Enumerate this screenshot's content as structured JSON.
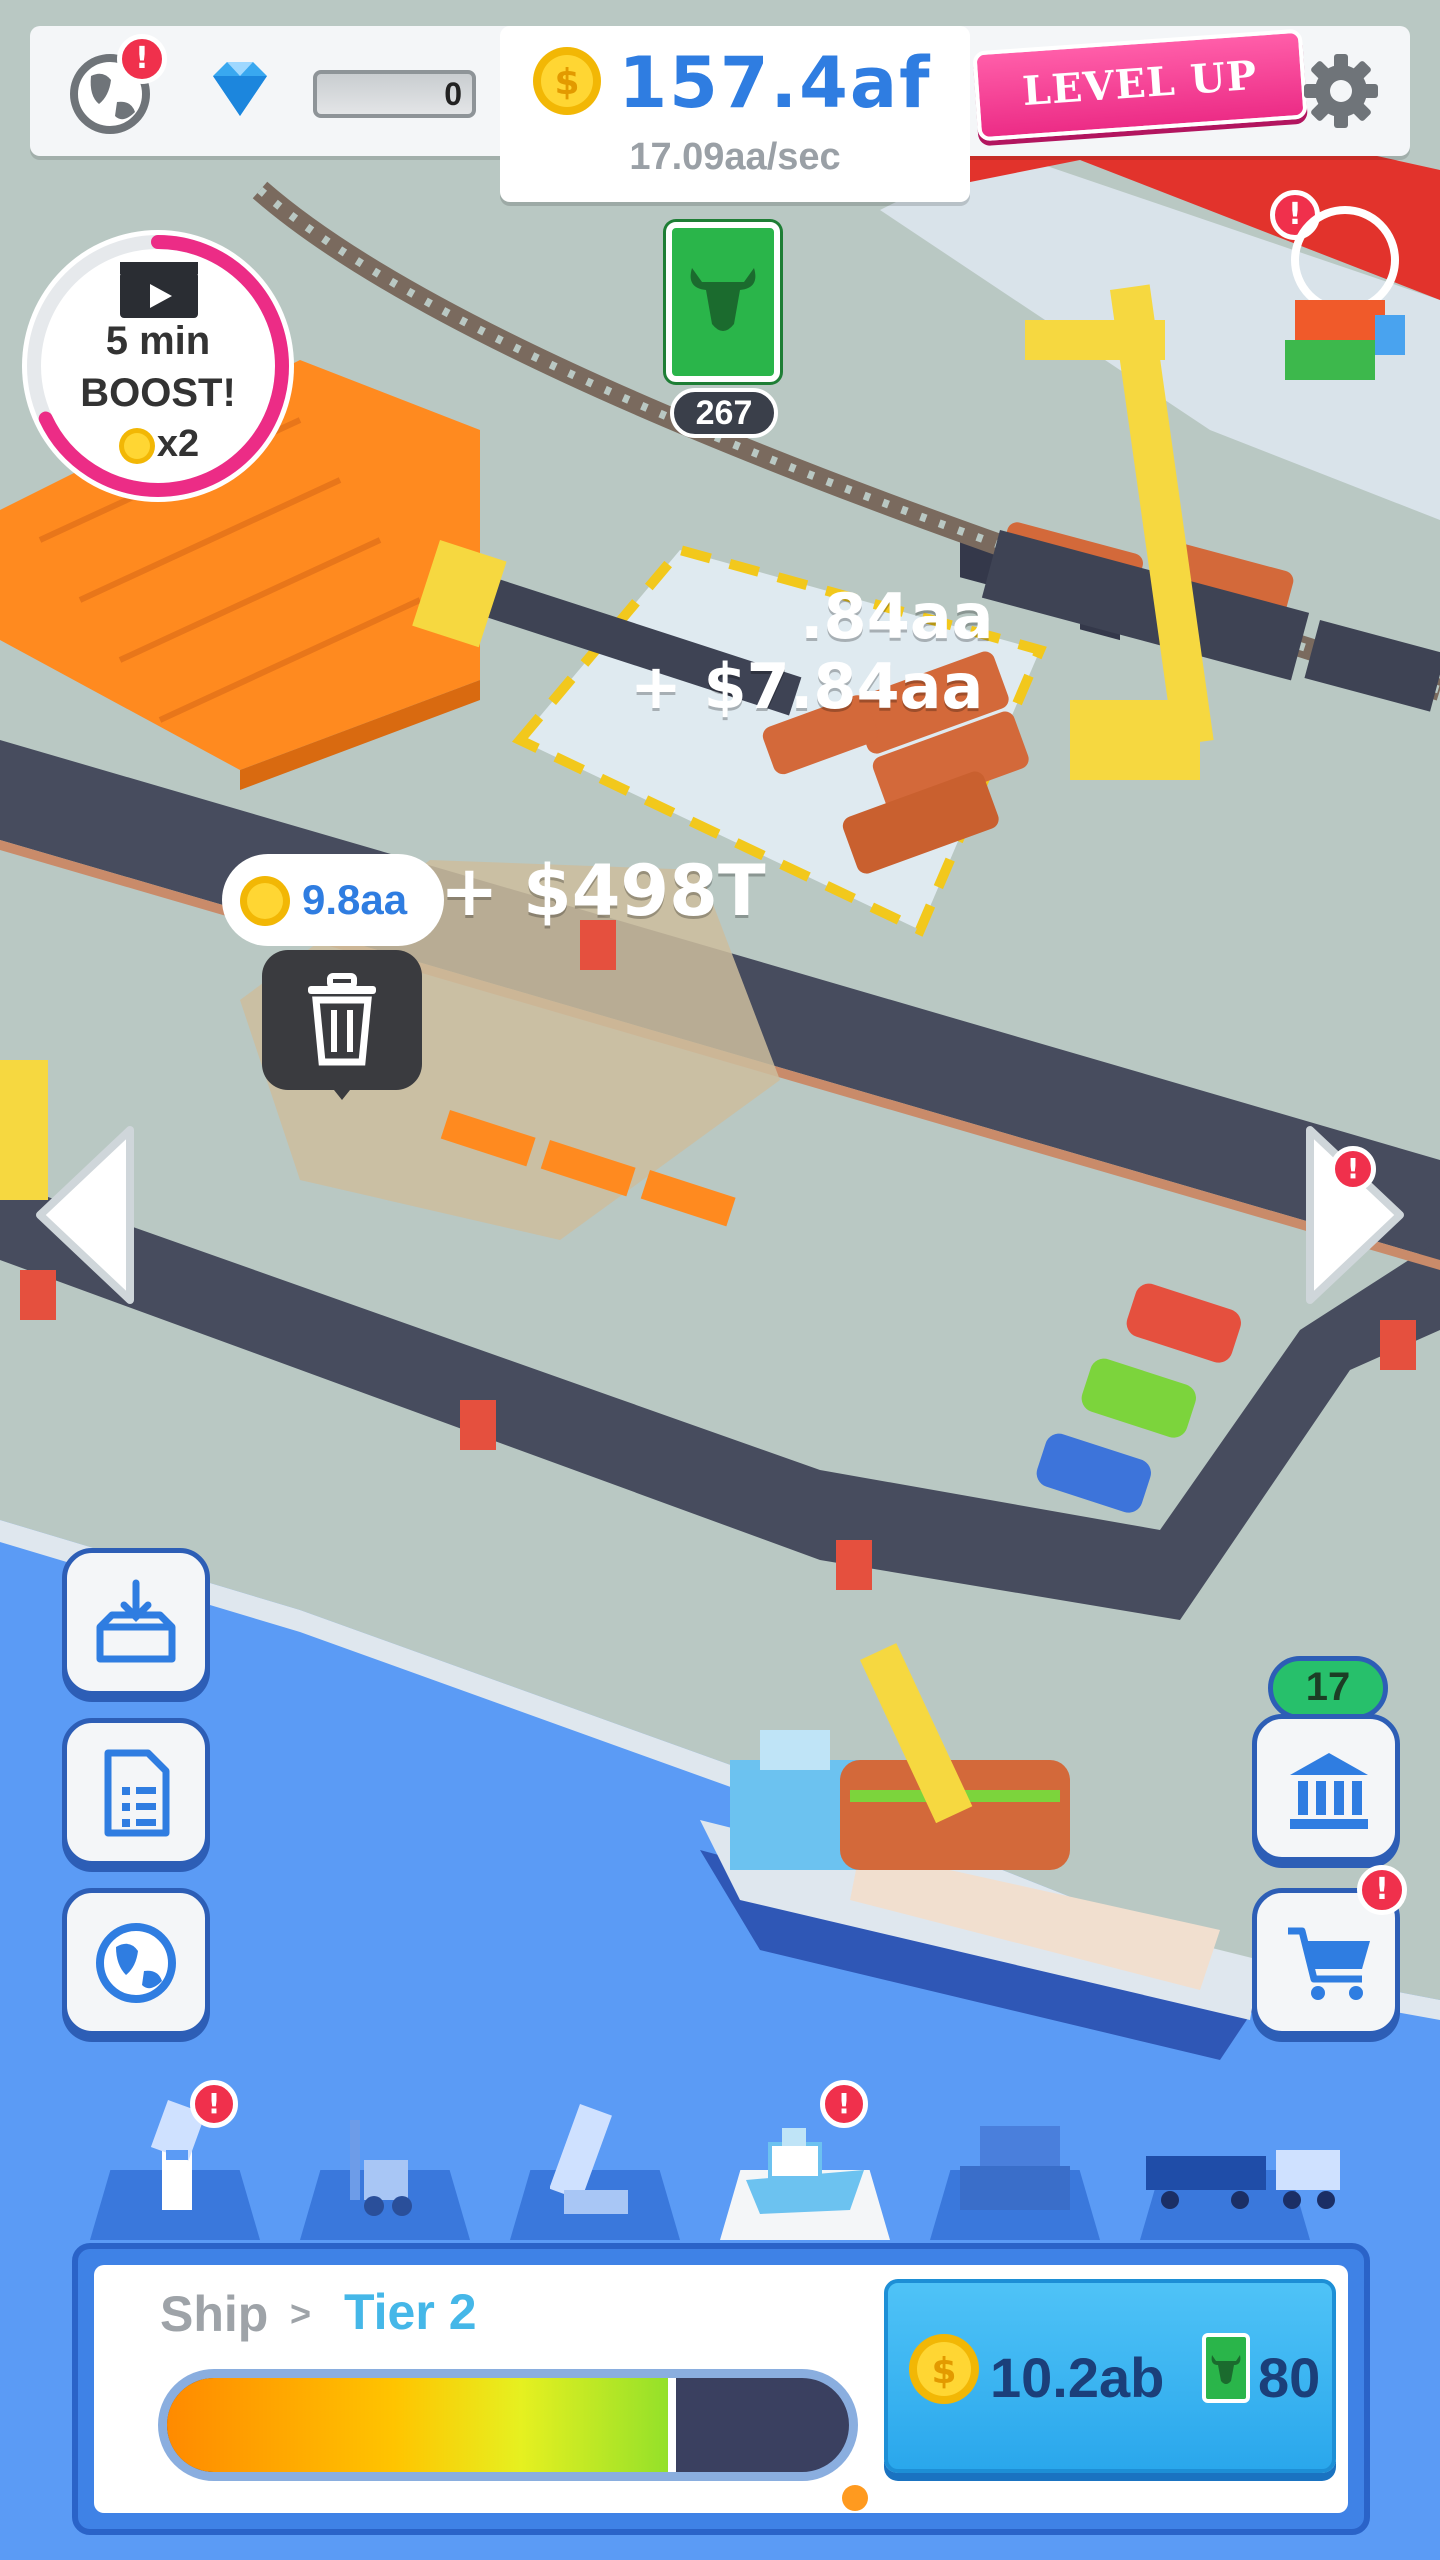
{
  "topbar": {
    "gems": "0",
    "money": "157.4af",
    "rate": "17.09aa/sec",
    "level_up_label": "LEVEL UP",
    "alert_mark": "!"
  },
  "resource": {
    "icon": "bull-icon",
    "count": "267"
  },
  "boost": {
    "line1": "5 min",
    "line2": "BOOST!",
    "multiplier": "x2",
    "progress": 0.68
  },
  "floating": {
    "text_a": ".84aa",
    "text_b": "+ $7.84aa",
    "text_c": "+ $498T",
    "bubble_value": "9.8aa"
  },
  "side_buttons": {
    "bank_count": "17"
  },
  "tabs": [
    {
      "name": "crane",
      "alert": true
    },
    {
      "name": "forklift",
      "alert": false
    },
    {
      "name": "loader",
      "alert": false
    },
    {
      "name": "ship",
      "alert": true,
      "active": true
    },
    {
      "name": "warehouse",
      "alert": false
    },
    {
      "name": "train",
      "alert": false
    }
  ],
  "panel": {
    "category": "Ship",
    "separator": ">",
    "tier": "Tier 2",
    "progress": 0.74,
    "price": "10.2ab",
    "resource_cost": "80"
  },
  "colors": {
    "accent_blue": "#2f7de1",
    "pink": "#ec2c86",
    "water": "#5b9bf5",
    "road": "#474c5e",
    "ground": "#b7c6c1",
    "badge_red": "#f0304c"
  }
}
